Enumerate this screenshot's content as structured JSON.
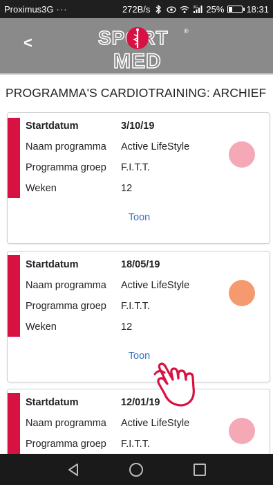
{
  "status_bar": {
    "carrier": "Proximus3G",
    "dots": "···",
    "speed": "272B/s",
    "battery": "25%",
    "battery_level": 0.25,
    "time": "18:31",
    "signal_tag": "3G"
  },
  "header": {
    "back_label": "<",
    "logo_text_top": "SPORT",
    "logo_text_bottom": "MED",
    "logo_mark": "®"
  },
  "page": {
    "title": "PROGRAMMA'S CARDIOTRAINING: ARCHIEF"
  },
  "labels": {
    "start": "Startdatum",
    "name": "Naam programma",
    "group": "Programma groep",
    "weeks": "Weken",
    "show": "Toon"
  },
  "colors": {
    "accent_stripe": "#d81143",
    "link": "#3a6fc4",
    "header_bg": "#8a8a8a"
  },
  "cards": [
    {
      "start": "3/10/19",
      "name": "Active LifeStyle",
      "group": "F.I.T.T.",
      "weeks": "12",
      "dot_color": "#f5a8b6"
    },
    {
      "start": "18/05/19",
      "name": "Active LifeStyle",
      "group": "F.I.T.T.",
      "weeks": "12",
      "dot_color": "#f59a6e"
    },
    {
      "start": "12/01/19",
      "name": "Active LifeStyle",
      "group": "F.I.T.T.",
      "weeks": "",
      "dot_color": "#f5a8b6"
    }
  ],
  "nav": {
    "back_icon": "triangle-back-icon",
    "home_icon": "circle-home-icon",
    "recents_icon": "square-recents-icon"
  }
}
